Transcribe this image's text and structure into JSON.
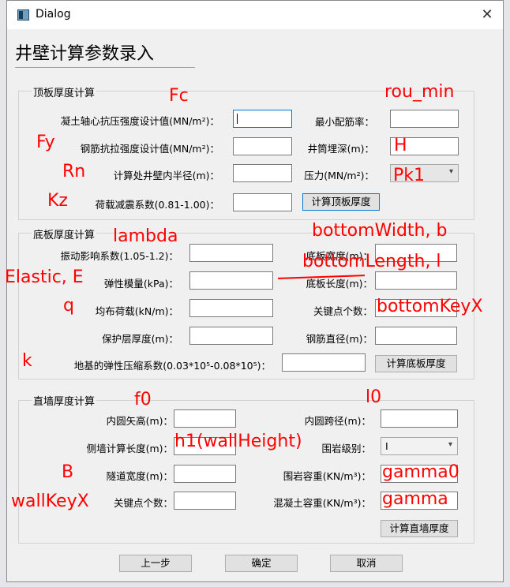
{
  "window": {
    "title": "Dialog",
    "close_glyph": "✕"
  },
  "page_title": "井壁计算参数录入",
  "roof": {
    "group_title": "顶板厚度计算",
    "concrete_strength": "凝土轴心抗压强度设计值(MN/m²)：",
    "min_reinforcement": "最小配筋率：",
    "steel_strength": "钢筋抗拉强度设计值(MN/m²)：",
    "shaft_depth": "井筒埋深(m)：",
    "inner_radius": "计算处井壁内半径(m)：",
    "pressure": "压力(MN/m²)：",
    "seismic_factor": "荷载减震系数(0.81-1.00)：",
    "calc_button": "计算顶板厚度"
  },
  "floor": {
    "group_title": "底板厚度计算",
    "vibration": "振动影响系数(1.05-1.2)：",
    "width": "底板宽度(m)：",
    "modulus": "弹性模量(kPa)：",
    "length": "底板长度(m)：",
    "load": "均布荷载(kN/m)：",
    "key_points": "关键点个数：",
    "cover": "保护层厚度(m)：",
    "rebar_dia": "钢筋直径(m)：",
    "foundation": "地基的弹性压缩系数(0.03*10⁵-0.08*10⁵)：",
    "calc_button": "计算底板厚度"
  },
  "wall": {
    "group_title": "直墙厚度计算",
    "arch_rise": "内圆矢高(m)：",
    "arch_span": "内圆跨径(m)：",
    "side_length": "侧墙计算长度(m)：",
    "rock_grade": "围岩级别：",
    "rock_grade_value": "I",
    "tunnel_width": "隧道宽度(m)：",
    "rock_density": "围岩容重(KN/m³)：",
    "key_points": "关键点个数：",
    "concrete_density": "混凝土容重(KN/m³)：",
    "calc_button": "计算直墙厚度"
  },
  "footer": {
    "prev": "上一步",
    "ok": "确定",
    "cancel": "取消"
  },
  "annotations": {
    "fc": "Fc",
    "rou_min": "rou_min",
    "fy": "Fy",
    "h": "H",
    "rn": "Rn",
    "pk1": "Pk1",
    "kz": "Kz",
    "lambda": "lambda",
    "bottom_width": "bottomWidth, b",
    "elastic": "Elastic, E",
    "bottom_length": "bottomLength, l",
    "q": "q",
    "bottom_key_x": "bottomKeyX",
    "k": "k",
    "f0": "f0",
    "l0": "l0",
    "h1": "h1(wallHeight)",
    "b_upper": "B",
    "gamma0": "gamma0",
    "wall_key_x": "wallKeyX",
    "gamma": "gamma"
  },
  "colors": {
    "annotation": "#ff0000",
    "focus": "#0078d7"
  }
}
